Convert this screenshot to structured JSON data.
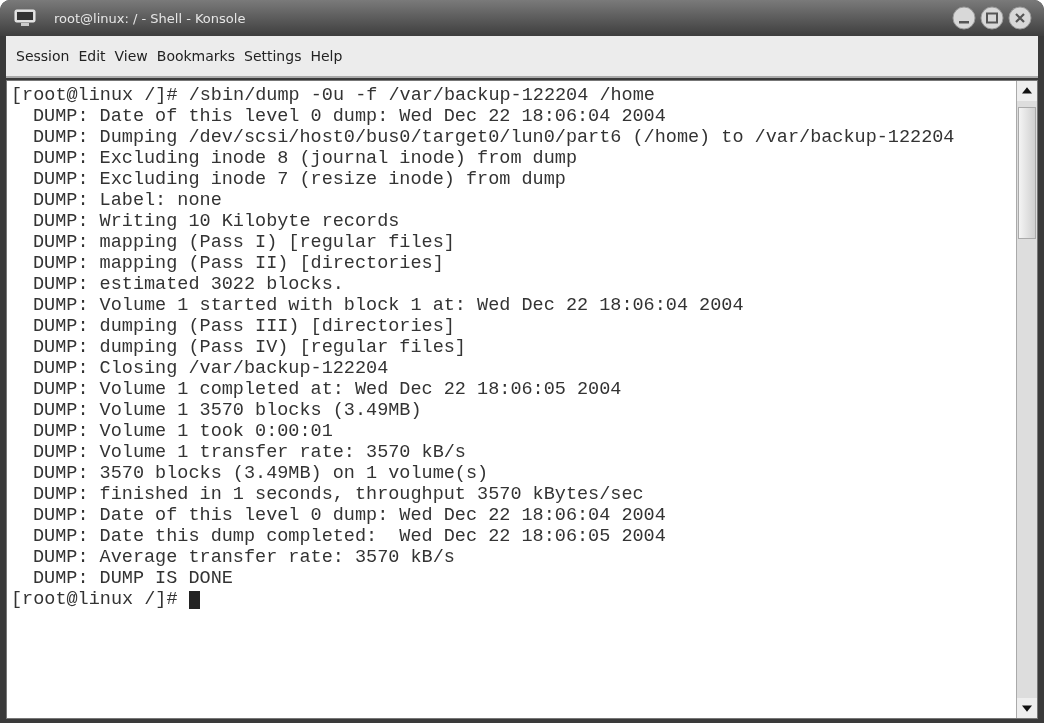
{
  "window": {
    "title": "root@linux: / - Shell - Konsole"
  },
  "menu": [
    "Session",
    "Edit",
    "View",
    "Bookmarks",
    "Settings",
    "Help"
  ],
  "terminal": {
    "lines": [
      {
        "kind": "prompt",
        "text": "[root@linux /]# /sbin/dump -0u -f /var/backup-122204 /home"
      },
      {
        "kind": "output",
        "text": "DUMP: Date of this level 0 dump: Wed Dec 22 18:06:04 2004"
      },
      {
        "kind": "output",
        "text": "DUMP: Dumping /dev/scsi/host0/bus0/target0/lun0/part6 (/home) to /var/backup-122204"
      },
      {
        "kind": "output",
        "text": "DUMP: Excluding inode 8 (journal inode) from dump"
      },
      {
        "kind": "output",
        "text": "DUMP: Excluding inode 7 (resize inode) from dump"
      },
      {
        "kind": "output",
        "text": "DUMP: Label: none"
      },
      {
        "kind": "output",
        "text": "DUMP: Writing 10 Kilobyte records"
      },
      {
        "kind": "output",
        "text": "DUMP: mapping (Pass I) [regular files]"
      },
      {
        "kind": "output",
        "text": "DUMP: mapping (Pass II) [directories]"
      },
      {
        "kind": "output",
        "text": "DUMP: estimated 3022 blocks."
      },
      {
        "kind": "output",
        "text": "DUMP: Volume 1 started with block 1 at: Wed Dec 22 18:06:04 2004"
      },
      {
        "kind": "output",
        "text": "DUMP: dumping (Pass III) [directories]"
      },
      {
        "kind": "output",
        "text": "DUMP: dumping (Pass IV) [regular files]"
      },
      {
        "kind": "output",
        "text": "DUMP: Closing /var/backup-122204"
      },
      {
        "kind": "output",
        "text": "DUMP: Volume 1 completed at: Wed Dec 22 18:06:05 2004"
      },
      {
        "kind": "output",
        "text": "DUMP: Volume 1 3570 blocks (3.49MB)"
      },
      {
        "kind": "output",
        "text": "DUMP: Volume 1 took 0:00:01"
      },
      {
        "kind": "output",
        "text": "DUMP: Volume 1 transfer rate: 3570 kB/s"
      },
      {
        "kind": "output",
        "text": "DUMP: 3570 blocks (3.49MB) on 1 volume(s)"
      },
      {
        "kind": "output",
        "text": "DUMP: finished in 1 seconds, throughput 3570 kBytes/sec"
      },
      {
        "kind": "output",
        "text": "DUMP: Date of this level 0 dump: Wed Dec 22 18:06:04 2004"
      },
      {
        "kind": "output",
        "text": "DUMP: Date this dump completed:  Wed Dec 22 18:06:05 2004"
      },
      {
        "kind": "output",
        "text": "DUMP: Average transfer rate: 3570 kB/s"
      },
      {
        "kind": "output",
        "text": "DUMP: DUMP IS DONE"
      },
      {
        "kind": "cursor",
        "text": "[root@linux /]#"
      }
    ]
  }
}
